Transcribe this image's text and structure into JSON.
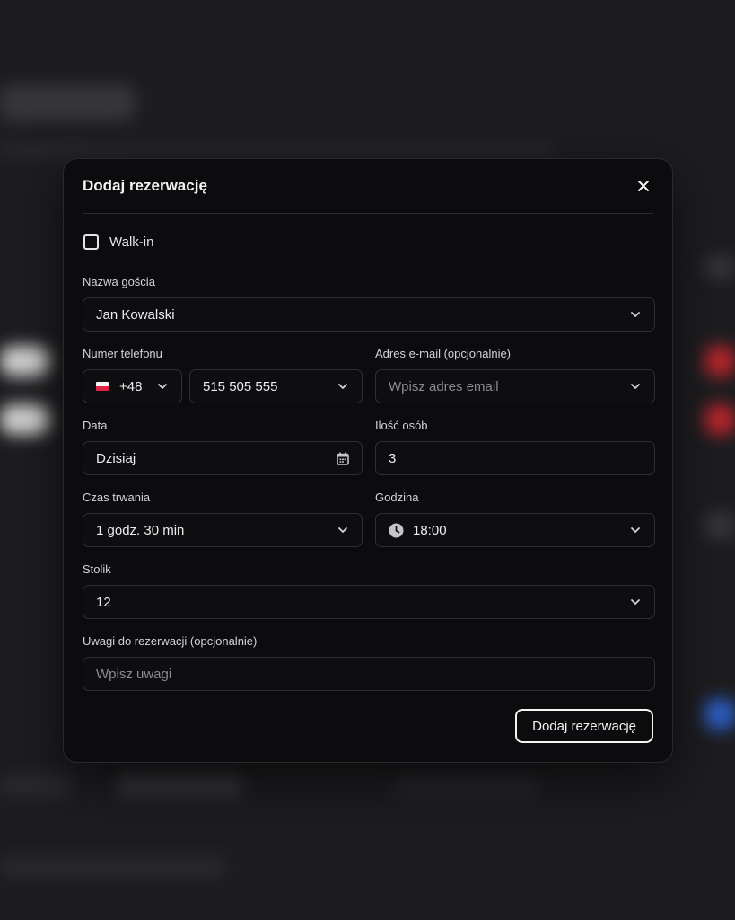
{
  "modal": {
    "title": "Dodaj rezerwację",
    "walkin_label": "Walk-in",
    "guest": {
      "label": "Nazwa gościa",
      "value": "Jan Kowalski"
    },
    "phone": {
      "label": "Numer telefonu",
      "country_code": "+48",
      "value": "515 505 555"
    },
    "email": {
      "label": "Adres e-mail (opcjonalnie)",
      "placeholder": "Wpisz adres email"
    },
    "date": {
      "label": "Data",
      "value": "Dzisiaj"
    },
    "people": {
      "label": "Ilość osób",
      "value": "3"
    },
    "duration": {
      "label": "Czas trwania",
      "value": "1 godz. 30 min"
    },
    "time": {
      "label": "Godzina",
      "value": "18:00"
    },
    "table": {
      "label": "Stolik",
      "value": "12"
    },
    "notes": {
      "label": "Uwagi do rezerwacji (opcjonalnie)",
      "placeholder": "Wpisz uwagi"
    },
    "submit_label": "Dodaj rezerwację"
  },
  "icons": {
    "close": "close-icon",
    "chevron": "chevron-down-icon",
    "calendar": "calendar-icon",
    "clock": "clock-icon",
    "flag": "poland-flag-icon"
  },
  "colors": {
    "background": "#1d1d20",
    "modal": "#0c0c0e",
    "border": "#2f2f34",
    "text": "#ececee",
    "placeholder": "#8b8b92"
  }
}
